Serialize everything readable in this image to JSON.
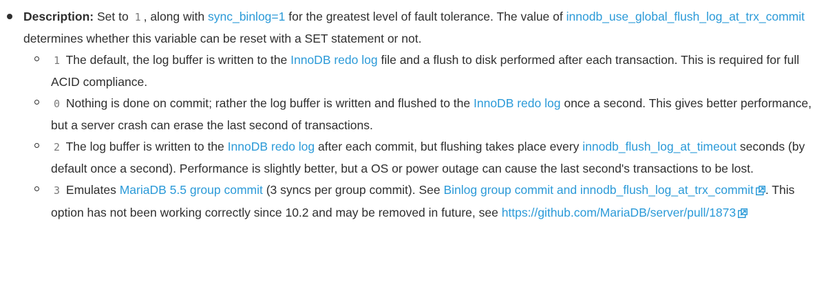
{
  "description": {
    "label": "Description:",
    "t1": " Set to ",
    "code": "1",
    "t2": ", along with ",
    "link_sync_binlog": "sync_binlog=1",
    "t3": " for the greatest level of fault tolerance. The value of ",
    "link_global_flush": "innodb_use_global_flush_log_at_trx_commit",
    "t4": " determines whether this variable can be reset with a SET statement or not."
  },
  "options": [
    {
      "code": "1",
      "t1": " The default, the log buffer is written to the ",
      "link1": "InnoDB redo log",
      "t2": " file and a flush to disk performed after each transaction. This is required for full ACID compliance."
    },
    {
      "code": "0",
      "t1": " Nothing is done on commit; rather the log buffer is written and flushed to the ",
      "link1": "InnoDB redo log",
      "t2": " once a second. This gives better performance, but a server crash can erase the last second of transactions."
    },
    {
      "code": "2",
      "t1": " The log buffer is written to the ",
      "link1": "InnoDB redo log",
      "t2": " after each commit, but flushing takes place every ",
      "link2": "innodb_flush_log_at_timeout",
      "t3": " seconds (by default once a second). Performance is slightly better, but a OS or power outage can cause the last second's transactions to be lost."
    },
    {
      "code": "3",
      "t1": " Emulates ",
      "link1": "MariaDB 5.5 group commit",
      "t2": " (3 syncs per group commit). See ",
      "link2": "Binlog group commit and innodb_flush_log_at_trx_commit",
      "t3": ". This option has not been working correctly since 10.2 and may be removed in future, see ",
      "link3": "https://github.com/MariaDB/server/pull/1873"
    }
  ],
  "icons": {
    "external_link": "external-link-icon"
  },
  "colors": {
    "text": "#2f2f2f",
    "link": "#2b9ad8",
    "code": "#7a7a7a"
  }
}
